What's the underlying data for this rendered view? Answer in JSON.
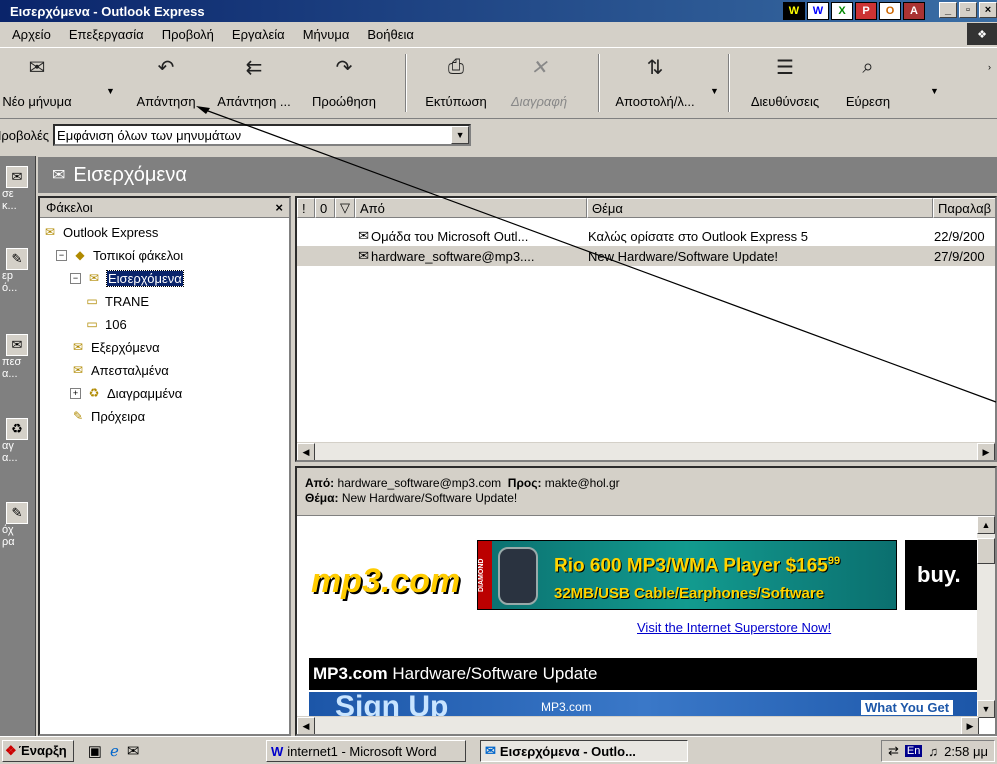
{
  "window": {
    "title": "Εισερχόμενα - Outlook Express"
  },
  "titlebar_apps": [
    "W",
    "X",
    "P",
    "O",
    "A"
  ],
  "menu": [
    "Αρχείο",
    "Επεξεργασία",
    "Προβολή",
    "Εργαλεία",
    "Μήνυμα",
    "Βοήθεια"
  ],
  "toolbar": [
    {
      "label": "Νέο μήνυμα",
      "icon": "new-message-icon",
      "glyph": "✉"
    },
    {
      "label": "Απάντηση",
      "icon": "reply-icon",
      "glyph": "↶"
    },
    {
      "label": "Απάντηση ...",
      "icon": "reply-all-icon",
      "glyph": "⇇"
    },
    {
      "label": "Προώθηση",
      "icon": "forward-icon",
      "glyph": "↷"
    },
    {
      "label": "Εκτύπωση",
      "icon": "print-icon",
      "glyph": "⎙"
    },
    {
      "label": "Διαγραφή",
      "icon": "delete-icon",
      "glyph": "✕"
    },
    {
      "label": "Αποστολή/λ...",
      "icon": "send-receive-icon",
      "glyph": "⇅"
    },
    {
      "label": "Διευθύνσεις",
      "icon": "address-book-icon",
      "glyph": "☰"
    },
    {
      "label": "Εύρεση",
      "icon": "find-icon",
      "glyph": "⌕"
    }
  ],
  "views": {
    "label": "Προβολές",
    "selected": "Εμφάνιση όλων των μηνυμάτων"
  },
  "outlook_bar": [
    {
      "label": "σε\nκ...",
      "glyph": "✉"
    },
    {
      "label": "εp\nό...",
      "glyph": "✎"
    },
    {
      "label": "πεσ\nα...",
      "glyph": "✉"
    },
    {
      "label": "αγ\nα...",
      "glyph": "♻"
    },
    {
      "label": "όχ\nρα",
      "glyph": "✎"
    }
  ],
  "folder_header": "Εισερχόμενα",
  "folders_pane": {
    "title": "Φάκελοι",
    "close": "×",
    "tree": [
      {
        "label": "Outlook Express",
        "level": 0,
        "expander": ""
      },
      {
        "label": "Τοπικοί φάκελοι",
        "level": 1,
        "expander": "−"
      },
      {
        "label": "Εισερχόμενα",
        "level": 2,
        "expander": "−",
        "selected": true
      },
      {
        "label": "TRANE",
        "level": 3,
        "expander": ""
      },
      {
        "label": "106",
        "level": 3,
        "expander": ""
      },
      {
        "label": "Εξερχόμενα",
        "level": 2,
        "expander": ""
      },
      {
        "label": "Απεσταλμένα",
        "level": 2,
        "expander": ""
      },
      {
        "label": "Διαγραμμένα",
        "level": 2,
        "expander": "+"
      },
      {
        "label": "Πρόχειρα",
        "level": 2,
        "expander": ""
      }
    ]
  },
  "message_list": {
    "columns": [
      "!",
      "0",
      "▽",
      "Από",
      "Θέμα",
      "Παραλαβ"
    ],
    "rows": [
      {
        "from": "Ομάδα του Microsoft Outl...",
        "subject": "Καλώς ορίσατε στο Outlook Express 5",
        "date": "22/9/200"
      },
      {
        "from": "hardware_software@mp3....",
        "subject": "New Hardware/Software Update!",
        "date": "27/9/200"
      }
    ]
  },
  "preview": {
    "from_label": "Από:",
    "from": "hardware_software@mp3.com",
    "to_label": "Προς:",
    "to": "makte@hol.gr",
    "subject_label": "Θέμα:",
    "subject": "New Hardware/Software Update!",
    "logo": "mp3.com",
    "banner_brand": "DIAMOND",
    "banner_line1": "Rio 600 MP3/WMA Player $165",
    "banner_cents": "99",
    "banner_line2": "32MB/USB Cable/Earphones/Software",
    "banner_buy": "buy.",
    "superstore_link": "Visit the Internet Superstore Now!",
    "section_brand": "MP3.com",
    "section_title": " Hardware/Software Update",
    "signup": "Sign Up",
    "signup_sub": "MP3.com",
    "what_you_get": "What You Get"
  },
  "taskbar": {
    "start": "Έναρξη",
    "tasks": [
      "internet1 - Microsoft Word",
      "Εισερχόμενα - Outlo..."
    ],
    "lang": "En",
    "clock": "2:58 μμ"
  }
}
